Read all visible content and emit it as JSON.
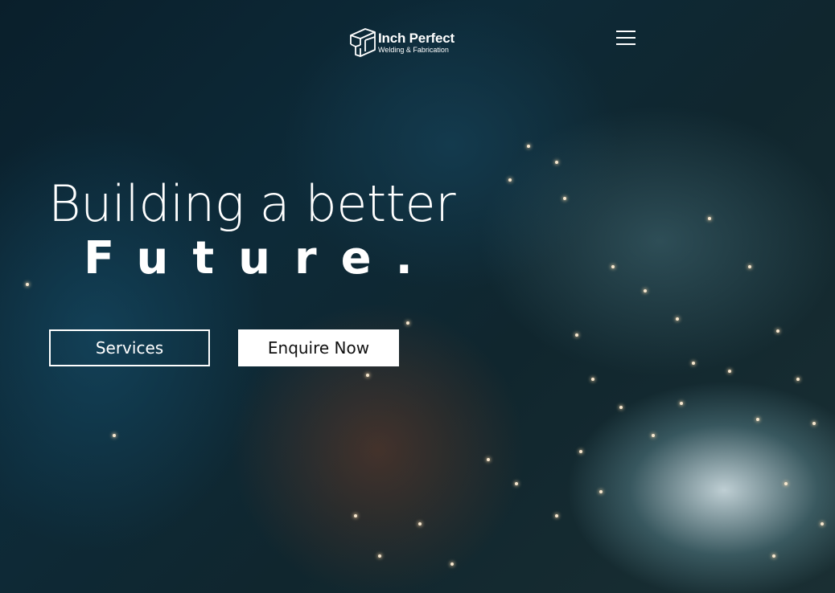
{
  "header": {
    "brand_name": "Inch Perfect",
    "brand_tagline": "Welding & Fabrication",
    "menu_icon": "hamburger-menu-icon"
  },
  "hero": {
    "headline_line1": "Building a better",
    "headline_line2": "Future."
  },
  "actions": {
    "services_label": "Services",
    "enquire_label": "Enquire Now"
  },
  "colors": {
    "text": "#ffffff",
    "primary_button_bg": "#ffffff",
    "primary_button_text": "#111111"
  }
}
